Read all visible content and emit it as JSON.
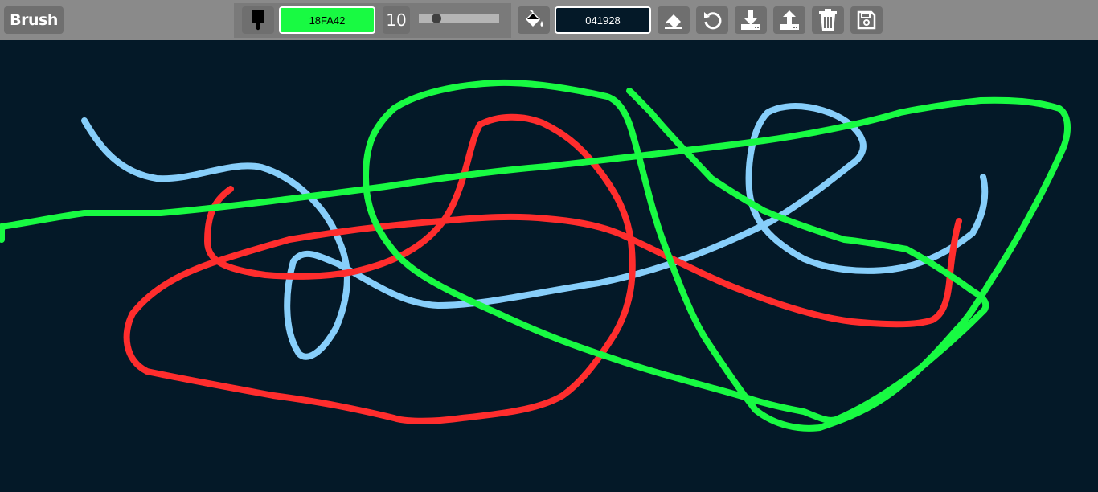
{
  "toolbar": {
    "mode_label": "Brush",
    "brush_color_hex": "18FA42",
    "brush_size": "10",
    "brush_size_slider_fraction": 0.22,
    "background_color_hex": "041928"
  },
  "colors": {
    "toolbar_bg": "#8a8a8a",
    "button_bg": "#6f6f6f",
    "brush_color": "#18FA42",
    "background_color": "#041928"
  },
  "icons": {
    "brush": "paint-brush-icon",
    "fill": "paint-bucket-icon",
    "eraser": "eraser-icon",
    "undo": "undo-icon",
    "download": "download-icon",
    "upload": "upload-icon",
    "clear": "trash-icon",
    "save": "floppy-disk-icon"
  },
  "canvas": {
    "strokes": [
      {
        "color": "#87CEFA",
        "name": "light-blue-stroke"
      },
      {
        "color": "#FF2D2D",
        "name": "red-stroke"
      },
      {
        "color": "#18FA42",
        "name": "green-stroke"
      }
    ]
  }
}
